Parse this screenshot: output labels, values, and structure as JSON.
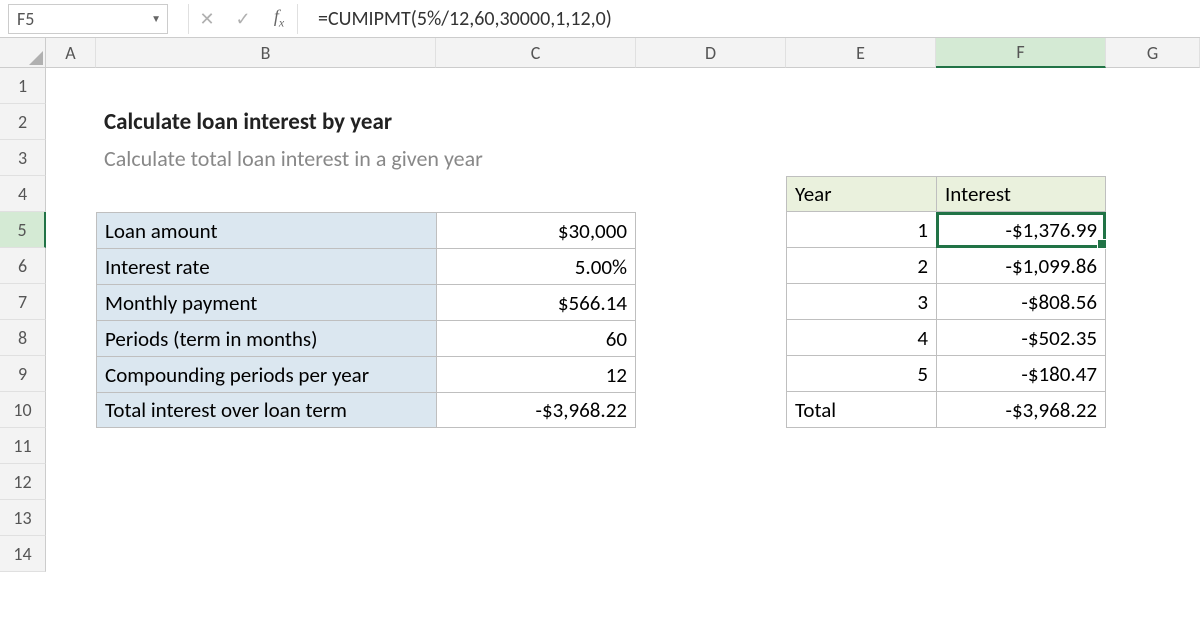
{
  "formula_bar": {
    "cell_ref": "F5",
    "formula": "=CUMIPMT(5%/12,60,30000,1,12,0)"
  },
  "columns": [
    "A",
    "B",
    "C",
    "D",
    "E",
    "F",
    "G"
  ],
  "rows_visible": 14,
  "title": "Calculate loan interest by year",
  "subtitle": "Calculate total loan interest in a given year",
  "loan_table": {
    "rows": [
      {
        "label": "Loan amount",
        "value": "$30,000"
      },
      {
        "label": "Interest rate",
        "value": "5.00%"
      },
      {
        "label": "Monthly payment",
        "value": "$566.14"
      },
      {
        "label": "Periods (term in months)",
        "value": "60"
      },
      {
        "label": "Compounding periods per year",
        "value": "12"
      },
      {
        "label": "Total interest over loan term",
        "value": "-$3,968.22"
      }
    ]
  },
  "year_table": {
    "headers": {
      "year": "Year",
      "interest": "Interest"
    },
    "rows": [
      {
        "year": "1",
        "interest": "-$1,376.99"
      },
      {
        "year": "2",
        "interest": "-$1,099.86"
      },
      {
        "year": "3",
        "interest": "-$808.56"
      },
      {
        "year": "4",
        "interest": "-$502.35"
      },
      {
        "year": "5",
        "interest": "-$180.47"
      }
    ],
    "total": {
      "label": "Total",
      "value": "-$3,968.22"
    }
  },
  "selection": {
    "col_index": 6,
    "row_index": 5
  }
}
